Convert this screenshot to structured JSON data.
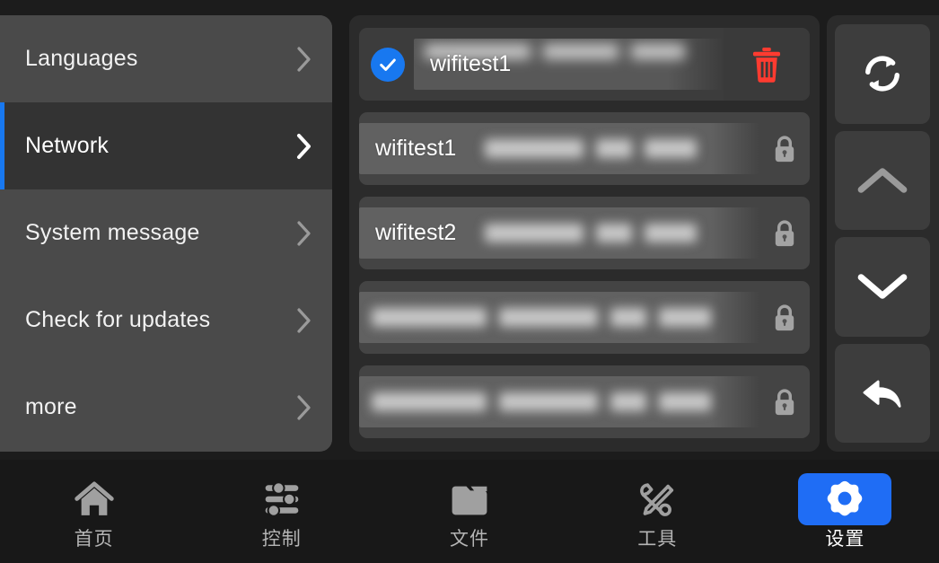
{
  "sidebar": {
    "items": [
      {
        "label": "Languages",
        "icon": "chevron-right-icon",
        "selected": false
      },
      {
        "label": "Network",
        "icon": "chevron-right-icon",
        "selected": true
      },
      {
        "label": "System message",
        "icon": "chevron-right-icon",
        "selected": false
      },
      {
        "label": "Check for updates",
        "icon": "chevron-right-icon",
        "selected": false
      },
      {
        "label": "more",
        "icon": "chevron-right-icon",
        "selected": false
      }
    ]
  },
  "wifi_panel": {
    "networks": [
      {
        "ssid": "wifitest1",
        "state": "connected",
        "connected_icon": "check-circle-icon",
        "action_icon": "trash-icon",
        "action_color": "#ff3b30",
        "meta_redacted": true
      },
      {
        "ssid": "wifitest1",
        "state": "available",
        "action_icon": "lock-icon",
        "meta_redacted": true
      },
      {
        "ssid": "wifitest2",
        "state": "available",
        "action_icon": "lock-icon",
        "meta_redacted": true
      },
      {
        "ssid": "",
        "state": "available",
        "action_icon": "lock-icon",
        "meta_redacted": true
      },
      {
        "ssid": "",
        "state": "available",
        "action_icon": "lock-icon",
        "meta_redacted": true
      }
    ]
  },
  "actions": {
    "buttons": [
      {
        "name": "refresh",
        "icon": "refresh-icon",
        "enabled": true
      },
      {
        "name": "scroll-up",
        "icon": "chevron-up-icon",
        "enabled": false
      },
      {
        "name": "scroll-down",
        "icon": "chevron-down-icon",
        "enabled": true
      },
      {
        "name": "back",
        "icon": "back-arrow-icon",
        "enabled": true
      }
    ]
  },
  "bottom_nav": {
    "active_index": 4,
    "items": [
      {
        "label": "首页",
        "icon": "home-icon"
      },
      {
        "label": "控制",
        "icon": "sliders-icon"
      },
      {
        "label": "文件",
        "icon": "folder-icon"
      },
      {
        "label": "工具",
        "icon": "tools-icon"
      },
      {
        "label": "设置",
        "icon": "gear-icon"
      }
    ]
  },
  "colors": {
    "accent": "#1878f0",
    "nav_active": "#1f6df5",
    "danger": "#ff3b30",
    "panel_bg": "#2b2b2b",
    "sidebar_bg": "#4a4a4a",
    "sidebar_selected_bg": "#333333",
    "row_bg": "#444444",
    "page_bg": "#1c1c1c",
    "nav_bg": "#181818"
  }
}
